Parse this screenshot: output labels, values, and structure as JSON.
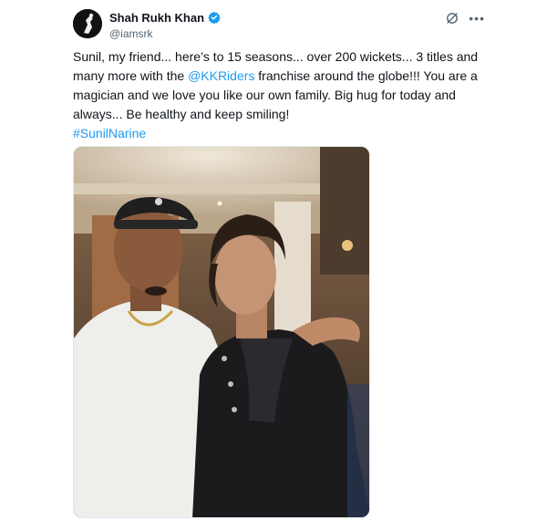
{
  "author": {
    "display_name": "Shah Rukh Khan",
    "handle": "@iamsrk",
    "verified": true,
    "avatar_icon": "avatar-silhouette"
  },
  "actions": {
    "grok_icon": "grok-icon",
    "more_icon": "more-icon"
  },
  "tweet": {
    "text_part1": "Sunil, my friend... here’s to 15 seasons... over 200 wickets... 3 titles and many more with the ",
    "mention": "@KKRiders",
    "text_part2": " franchise around the globe!!! You are a magician and we love you like our own family. Big hug for today and always... Be healthy and keep smiling!",
    "hashtag": "#SunilNarine"
  },
  "colors": {
    "link": "#1d9bf0",
    "text": "#0f1419",
    "secondary": "#536471"
  }
}
